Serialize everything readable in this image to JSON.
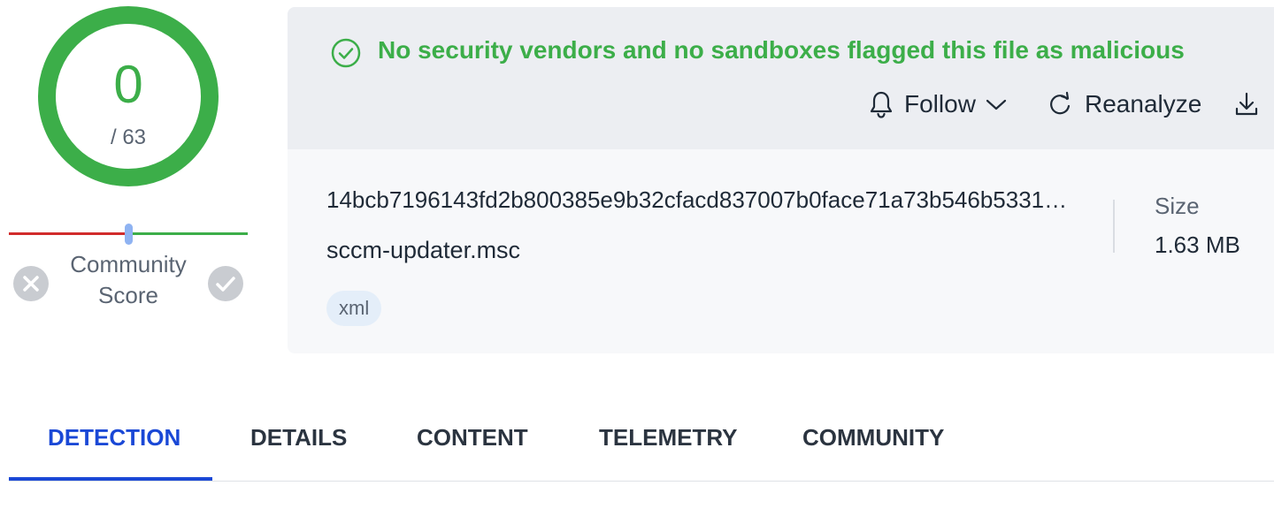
{
  "score": {
    "detections": "0",
    "total": "/ 63",
    "color": "#3cae49"
  },
  "community": {
    "label": "Community Score",
    "value_fraction": 0.5
  },
  "verdict": {
    "icon": "check-circle-icon",
    "text": "No security vendors and no sandboxes flagged this file as malicious",
    "color": "#3cae49"
  },
  "actions": {
    "follow_label": "Follow",
    "reanalyze_label": "Reanalyze"
  },
  "file": {
    "hash": "14bcb7196143fd2b800385e9b32cfacd837007b0face71a73b546b5331…",
    "name": "sccm-updater.msc",
    "tag": "xml",
    "size_label": "Size",
    "size_value": "1.63 MB"
  },
  "tabs": [
    {
      "label": "DETECTION",
      "active": true
    },
    {
      "label": "DETAILS"
    },
    {
      "label": "CONTENT"
    },
    {
      "label": "TELEMETRY"
    },
    {
      "label": "COMMUNITY"
    }
  ],
  "colors": {
    "accent": "#1a48d6",
    "danger": "#d12b2b",
    "safe": "#3cae49"
  }
}
